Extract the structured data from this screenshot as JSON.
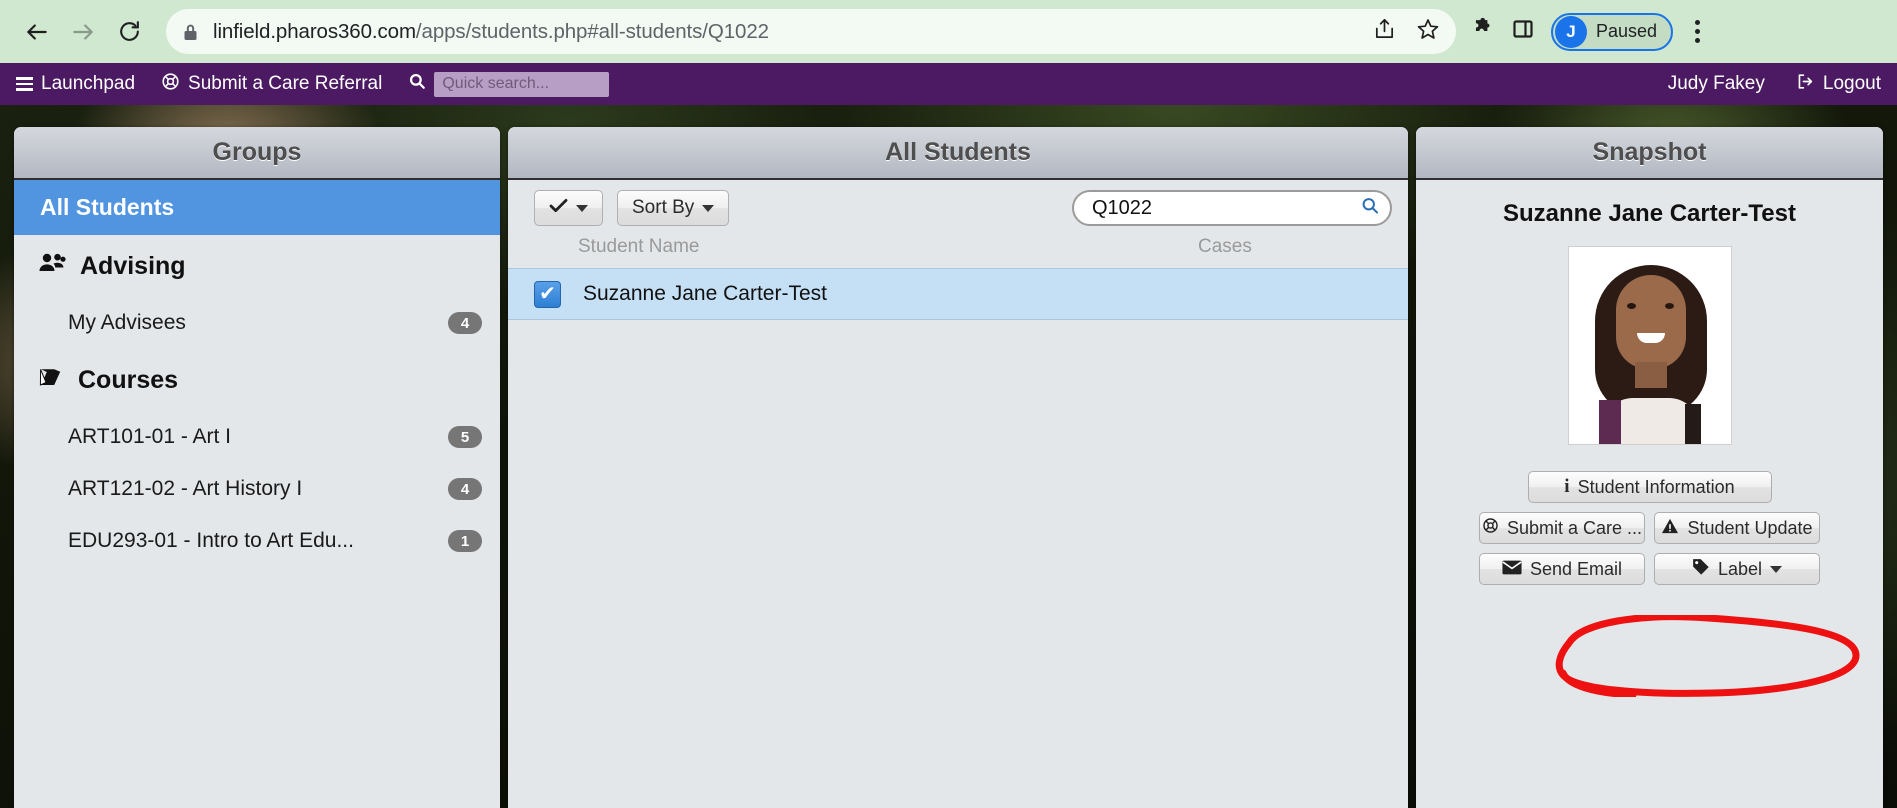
{
  "browser": {
    "url_domain": "linfield.pharos360.com",
    "url_path": "/apps/students.php#all-students/Q1022",
    "back_icon": "back-arrow-icon",
    "forward_icon": "forward-arrow-icon",
    "reload_icon": "reload-icon",
    "lock_icon": "lock-icon",
    "share_icon": "share-icon",
    "bookmark_icon": "star-icon",
    "extensions_icon": "puzzle-icon",
    "sidebar_icon": "sidebar-panel-icon",
    "profile_initial": "J",
    "profile_status": "Paused",
    "menu_icon": "kebab-menu-icon"
  },
  "appnav": {
    "launchpad": "Launchpad",
    "care_referral": "Submit a Care Referral",
    "search_placeholder": "Quick search...",
    "user_name": "Judy Fakey",
    "logout": "Logout"
  },
  "groups": {
    "title": "Groups",
    "all_students": "All Students",
    "sections": [
      {
        "label": "Advising",
        "icon": "users-icon",
        "items": [
          {
            "label": "My Advisees",
            "count": "4"
          }
        ]
      },
      {
        "label": "Courses",
        "icon": "book-icon",
        "items": [
          {
            "label": "ART101-01 - Art I",
            "count": "5"
          },
          {
            "label": "ART121-02 - Art History I",
            "count": "4"
          },
          {
            "label": "EDU293-01 - Intro to Art Edu...",
            "count": "1"
          }
        ]
      }
    ]
  },
  "students": {
    "title": "All Students",
    "select_all_label": "",
    "sort_by_label": "Sort By",
    "search_value": "Q1022",
    "search_icon": "magnifier-icon",
    "columns": {
      "name": "Student Name",
      "cases": "Cases"
    },
    "rows": [
      {
        "name": "Suzanne Jane Carter-Test",
        "checked": "✔",
        "cases": ""
      }
    ]
  },
  "snapshot": {
    "title": "Snapshot",
    "student_name": "Suzanne Jane Carter-Test",
    "photo_alt": "student-photo",
    "buttons": [
      {
        "label": "Student Information",
        "icon": "info-icon"
      },
      {
        "label": "Submit a Care ...",
        "icon": "lifering-icon"
      },
      {
        "label": "Student Update",
        "icon": "warning-triangle-icon"
      },
      {
        "label": "Send Email",
        "icon": "envelope-icon"
      },
      {
        "label": "Label",
        "icon": "tag-icon"
      }
    ]
  },
  "annotation": {
    "target": "Student Update",
    "color": "#ee1111"
  },
  "colors": {
    "nav_purple": "#4b1a62",
    "selected_blue": "#5195e0",
    "row_blue": "#c5e0f5",
    "panel_gray": "#e3e7e9",
    "annotation_red": "#ee1111"
  }
}
